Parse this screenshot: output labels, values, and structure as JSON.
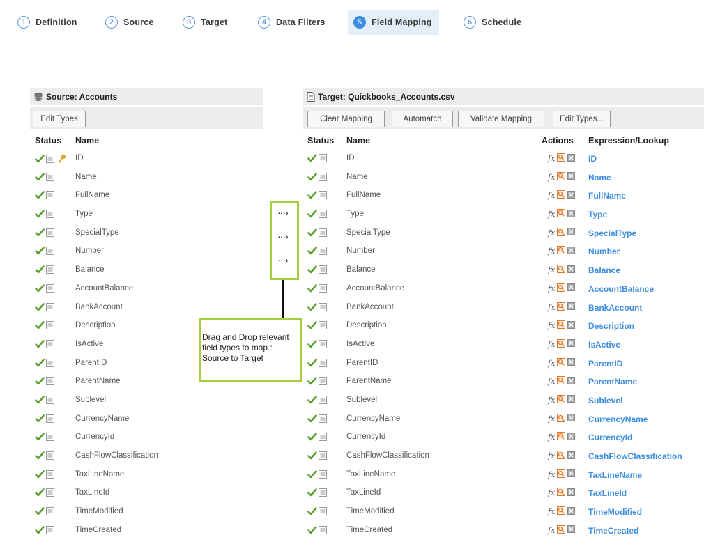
{
  "steps": [
    {
      "num": "1",
      "label": "Definition"
    },
    {
      "num": "2",
      "label": "Source"
    },
    {
      "num": "3",
      "label": "Target"
    },
    {
      "num": "4",
      "label": "Data Filters"
    },
    {
      "num": "5",
      "label": "Field Mapping"
    },
    {
      "num": "6",
      "label": "Schedule"
    }
  ],
  "active_step": 5,
  "source": {
    "title": "Source: Accounts",
    "edit_types_label": "Edit Types",
    "col_status": "Status",
    "col_name": "Name"
  },
  "target": {
    "title": "Target: Quickbooks_Accounts.csv",
    "clear_mapping_label": "Clear Mapping",
    "automatch_label": "Automatch",
    "validate_mapping_label": "Validate Mapping",
    "edit_types_label": "Edit Types...",
    "col_status": "Status",
    "col_name": "Name",
    "col_actions": "Actions",
    "col_expression": "Expression/Lookup",
    "fx_label": "fx"
  },
  "fields": [
    "ID",
    "Name",
    "FullName",
    "Type",
    "SpecialType",
    "Number",
    "Balance",
    "AccountBalance",
    "BankAccount",
    "Description",
    "IsActive",
    "ParentID",
    "ParentName",
    "Sublevel",
    "CurrencyName",
    "CurrencyId",
    "CashFlowClassification",
    "TaxLineName",
    "TaxLineId",
    "TimeModified",
    "TimeCreated"
  ],
  "annotation": {
    "arrows": [
      "···›",
      "···›",
      "···›"
    ],
    "note_text": "Drag and Drop relevant field types to map : Source to Target"
  },
  "colors": {
    "accent_blue": "#3d8ee0",
    "check_green": "#5aa02c",
    "key_gold": "#e0a020",
    "annotation_green": "#a6cf3c"
  },
  "icons": {
    "status_valid": "check-icon",
    "field_doc": "document-icon",
    "primary_key": "key-icon",
    "source_panel": "database-icon",
    "target_panel": "file-icon",
    "lookup": "lookup-icon",
    "clear_row": "clear-icon"
  }
}
